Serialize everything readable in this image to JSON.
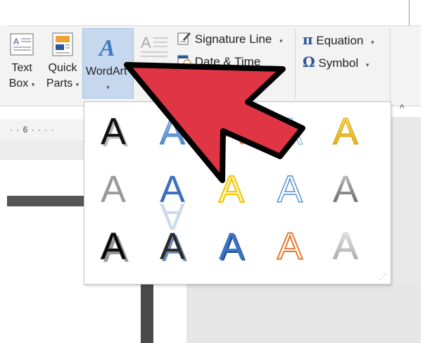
{
  "ribbon": {
    "text_box": {
      "line1": "Text",
      "line2": "Box",
      "icon": "text-box-icon"
    },
    "quick_parts": {
      "line1": "Quick",
      "line2": "Parts",
      "icon": "quick-parts-icon"
    },
    "wordart": {
      "line1": "WordArt",
      "icon": "wordart-icon"
    },
    "drop_cap": {
      "icon": "drop-cap-icon"
    },
    "signature_line": {
      "label": "Signature Line",
      "icon": "signature-line-icon"
    },
    "date_time": {
      "label": "Date & Time",
      "icon": "date-time-icon"
    },
    "equation": {
      "label": "Equation",
      "symbol": "π",
      "icon": "equation-icon"
    },
    "symbol": {
      "label": "Symbol",
      "symbol": "Ω",
      "icon": "symbol-icon"
    },
    "caret": "▾",
    "collapse": "^"
  },
  "ruler": {
    "text": "· · 6 · · · ·"
  },
  "wordart_gallery": {
    "glyph": "A",
    "styles": [
      [
        "black-shadow",
        "blue-gradient",
        "orange-gradient",
        "blue-outline-light",
        "gold"
      ],
      [
        "gray-fill",
        "blue-reflection",
        "gold-outline",
        "blue-outline",
        "gray-gradient"
      ],
      [
        "black-outline-shadow",
        "dark-bevel",
        "blue-bevel",
        "orange-outline",
        "silver-gradient"
      ]
    ],
    "grip": "⋰"
  },
  "colors": {
    "arrow_fill": "#e03545",
    "arrow_stroke": "#000000",
    "wordart_highlight": "#c6d8ee",
    "ribbon_bg": "#f3f3f3",
    "accent_blue": "#2b5797"
  }
}
